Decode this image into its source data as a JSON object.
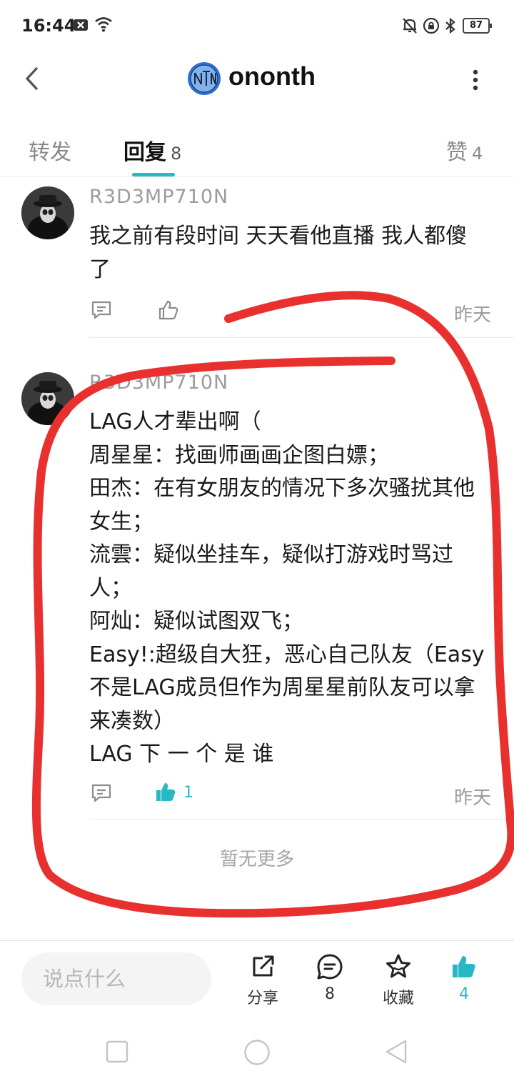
{
  "status_bar": {
    "time": "16:44",
    "battery": "87"
  },
  "header": {
    "title": "ononth",
    "logo_text": "NTN"
  },
  "tabs": [
    {
      "label": "转发",
      "count": ""
    },
    {
      "label": "回复",
      "count": "8"
    },
    {
      "label": "赞",
      "count": "4"
    }
  ],
  "comments": [
    {
      "username": "R3D3MP710N",
      "lines": [
        "我之前有段时间 天天看他直播 我人都傻",
        "了"
      ],
      "date": "昨天",
      "like_count": ""
    },
    {
      "username": "R3D3MP710N",
      "lines": [
        "LAG人才辈出啊（",
        "周星星：找画师画画企图白嫖；",
        "田杰：在有女朋友的情况下多次骚扰其他",
        "女生；",
        "流雲：疑似坐挂车，疑似打游戏时骂过",
        "人；",
        "阿灿：疑似试图双飞；",
        "Easy!:超级自大狂，恶心自己队友（Easy",
        "不是LAG成员但作为周星星前队友可以拿",
        "来凑数）",
        "LAG 下 一 个 是 谁"
      ],
      "date": "昨天",
      "like_count": "1"
    }
  ],
  "no_more": "暂无更多",
  "bottom_bar": {
    "input_placeholder": "说点什么",
    "share_label": "分享",
    "comment_count": "8",
    "favorite_label": "收藏",
    "like_count": "4"
  },
  "colors": {
    "accent": "#27b8c6",
    "annotation": "#e8312f"
  }
}
